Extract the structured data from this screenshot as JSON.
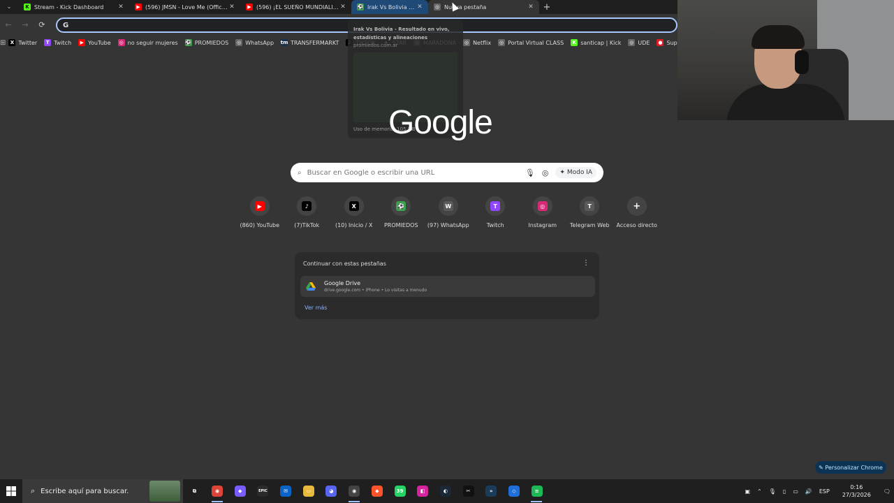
{
  "tabs": [
    {
      "title": "Stream - Kick Dashboard",
      "fav": "K",
      "fav_color": "#53fc18",
      "fav_text": "#000"
    },
    {
      "title": "(596) JMSN - Love Me (Official",
      "fav": "▶",
      "fav_color": "#ff0000",
      "fav_text": "#fff"
    },
    {
      "title": "(596) ¡EL SUEÑO MUNDIALISTA",
      "fav": "▶",
      "fav_color": "#ff0000",
      "fav_text": "#fff"
    },
    {
      "title": "Irak Vs Bolivia - R",
      "fav": "⚽",
      "fav_color": "#3aa04a",
      "fav_text": "#fff"
    },
    {
      "title": "Nueva pestaña",
      "fav": "◎",
      "fav_color": "#666",
      "fav_text": "#fff"
    }
  ],
  "tabbar": {
    "menu_icon": "chevron-down-icon",
    "close": "✕",
    "new_tab": "+"
  },
  "toolbar": {
    "back": "←",
    "forward": "→",
    "reload": "⟳",
    "omnibox_value": "",
    "omnibox_g": "G"
  },
  "bookmarks": [
    {
      "label": "Twitter",
      "ic": "X",
      "color": "#000"
    },
    {
      "label": "Twitch",
      "ic": "T",
      "color": "#9146ff"
    },
    {
      "label": "YouTube",
      "ic": "▶",
      "color": "#ff0000"
    },
    {
      "label": "no seguir mujeres",
      "ic": "◎",
      "color": "#d62976"
    },
    {
      "label": "PROMIEDOS",
      "ic": "⚽",
      "color": "#3aa04a"
    },
    {
      "label": "WhatsApp",
      "ic": "◎",
      "color": "#666"
    },
    {
      "label": "TRANSFERMARKT",
      "ic": "tm",
      "color": "#1a3151"
    },
    {
      "label": "TIKTOK",
      "ic": "♪",
      "color": "#000"
    },
    {
      "label": "STAR",
      "ic": "★",
      "color": "#333"
    },
    {
      "label": "MARADONA",
      "ic": "◎",
      "color": "#666"
    },
    {
      "label": "Netflix",
      "ic": "◎",
      "color": "#666"
    },
    {
      "label": "Portal Virtual CLASS",
      "ic": "◎",
      "color": "#666"
    },
    {
      "label": "santicap | Kick",
      "ic": "K",
      "color": "#53fc18"
    },
    {
      "label": "UDE",
      "ic": "◎",
      "color": "#666"
    },
    {
      "label": "Super",
      "ic": "●",
      "color": "#e21b23"
    }
  ],
  "hovercard": {
    "title": "Irak Vs Bolivia - Resultado en vivo, estadísticas y alineaciones",
    "url": "promiedos.com.ar",
    "memory": "Uso de memoria: 105 MB"
  },
  "logo": "Google",
  "search": {
    "placeholder": "Buscar en Google o escribir una URL",
    "ai_mode": "Modo IA"
  },
  "shortcuts": [
    {
      "label": "(860) YouTube",
      "ic": "▶",
      "color": "#ff0000"
    },
    {
      "label": "(7)TikTok",
      "ic": "♪",
      "color": "#000"
    },
    {
      "label": "(10) Inicio / X",
      "ic": "X",
      "color": "#000"
    },
    {
      "label": "PROMIEDOS",
      "ic": "⚽",
      "color": "#3aa04a"
    },
    {
      "label": "(97) WhatsApp",
      "ic": "W",
      "color": "#5a5a5a"
    },
    {
      "label": "Twitch",
      "ic": "T",
      "color": "#9146ff"
    },
    {
      "label": "Instagram",
      "ic": "◎",
      "color": "#d62976"
    },
    {
      "label": "Telegram Web",
      "ic": "T",
      "color": "#5a5a5a"
    },
    {
      "label": "Acceso directo",
      "ic": "+",
      "color": "transparent"
    }
  ],
  "continue_card": {
    "title": "Continuar con estas pestañas",
    "item_title": "Google Drive",
    "item_sub": "drive.google.com • iPhone • Lo visitas a menudo",
    "more": "Ver más"
  },
  "customize": "Personalizar Chrome",
  "taskbar": {
    "search_text": "Escribe aquí para buscar.",
    "apps": [
      {
        "name": "task-view",
        "ic": "⧉",
        "color": "transparent"
      },
      {
        "name": "chrome",
        "ic": "◉",
        "color": "#db4437",
        "active": true
      },
      {
        "name": "copilot",
        "ic": "◆",
        "color": "#7b5cff"
      },
      {
        "name": "epic",
        "ic": "EPIC",
        "color": "#2a2a2a"
      },
      {
        "name": "mail",
        "ic": "✉",
        "color": "#0a64c8"
      },
      {
        "name": "explorer",
        "ic": "▭",
        "color": "#e8b93c"
      },
      {
        "name": "discord",
        "ic": "◕",
        "color": "#5865f2"
      },
      {
        "name": "chrome-alt",
        "ic": "◉",
        "color": "#444",
        "active": true
      },
      {
        "name": "brave",
        "ic": "◆",
        "color": "#fb542b"
      },
      {
        "name": "whatsapp",
        "ic": "39",
        "color": "#25d366"
      },
      {
        "name": "app-pink",
        "ic": "◧",
        "color": "#d6249f"
      },
      {
        "name": "steam",
        "ic": "◐",
        "color": "#1b2838"
      },
      {
        "name": "capcut",
        "ic": "✂",
        "color": "#111"
      },
      {
        "name": "terminal",
        "ic": "»",
        "color": "#1b3b5a"
      },
      {
        "name": "shield",
        "ic": "◇",
        "color": "#1e6fd9"
      },
      {
        "name": "spotify",
        "ic": "≡",
        "color": "#1db954",
        "active": true
      }
    ],
    "tray_lang": "ESP",
    "time": "0:16",
    "date": "27/3/2026"
  }
}
